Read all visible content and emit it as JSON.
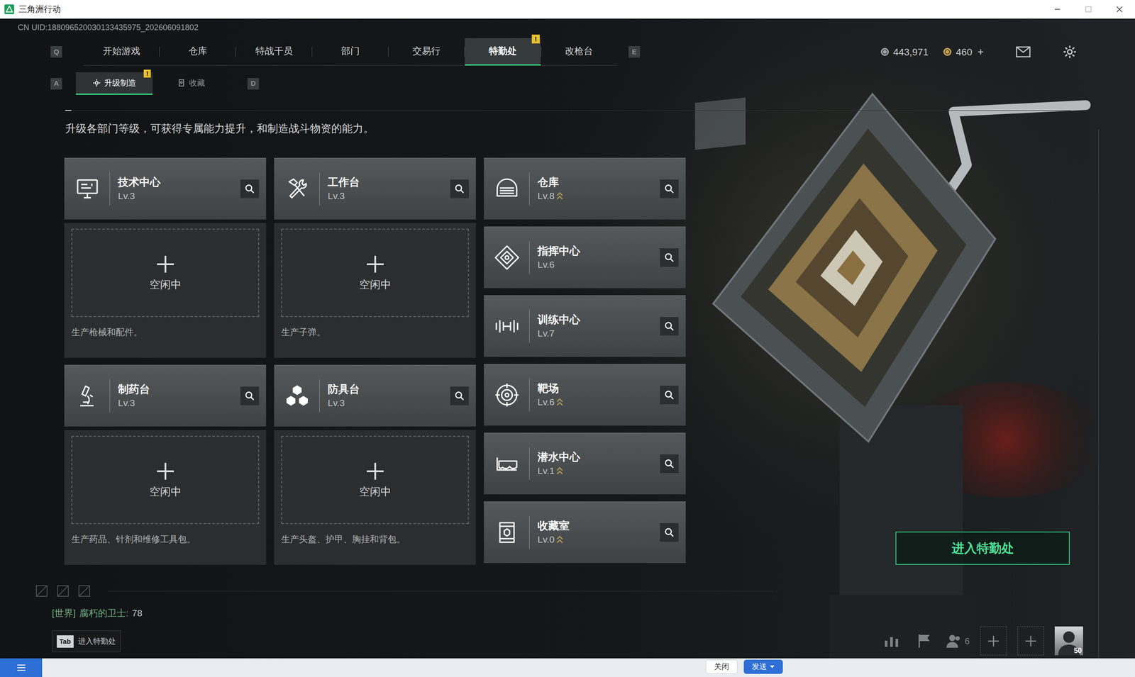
{
  "window": {
    "title": "三角洲行动"
  },
  "uid": "CN UID:188096520030133435975_202606091802",
  "nav": {
    "left_key": "Q",
    "right_key": "E",
    "tabs": [
      {
        "label": "开始游戏",
        "selected": false
      },
      {
        "label": "仓库",
        "selected": false
      },
      {
        "label": "特战干员",
        "selected": false
      },
      {
        "label": "部门",
        "selected": false
      },
      {
        "label": "交易行",
        "selected": false
      },
      {
        "label": "特勤处",
        "selected": true,
        "badge": "!"
      },
      {
        "label": "改枪台",
        "selected": false
      }
    ]
  },
  "currency": [
    {
      "amount": "443,971"
    },
    {
      "amount": "460",
      "add": "+"
    }
  ],
  "subnav": {
    "left_key": "A",
    "right_key": "D",
    "tabs": [
      {
        "label": "升级制造",
        "selected": true,
        "badge": "!"
      },
      {
        "label": "收藏",
        "selected": false
      }
    ]
  },
  "description": "升级各部门等级，可获得专属能力提升，和制造战斗物资的能力。",
  "stations": [
    {
      "name": "技术中心",
      "level": "Lv.3",
      "status": "空闲中",
      "caption": "生产枪械和配件。"
    },
    {
      "name": "工作台",
      "level": "Lv.3",
      "status": "空闲中",
      "caption": "生产子弹。"
    },
    {
      "name": "制药台",
      "level": "Lv.3",
      "status": "空闲中",
      "caption": "生产药品、针剂和维修工具包。"
    },
    {
      "name": "防具台",
      "level": "Lv.3",
      "status": "空闲中",
      "caption": "生产头盔、护甲、胸挂和背包。"
    }
  ],
  "departments": [
    {
      "name": "仓库",
      "level": "Lv.8",
      "upgradable": true
    },
    {
      "name": "指挥中心",
      "level": "Lv.6",
      "upgradable": false
    },
    {
      "name": "训练中心",
      "level": "Lv.7",
      "upgradable": false
    },
    {
      "name": "靶场",
      "level": "Lv.6",
      "upgradable": true
    },
    {
      "name": "潜水中心",
      "level": "Lv.1",
      "upgradable": true
    },
    {
      "name": "收藏室",
      "level": "Lv.0",
      "upgradable": true
    }
  ],
  "enter_button": "进入特勤处",
  "chat": {
    "channel": "[世界]",
    "sender": "腐朽的卫士:",
    "message": "78"
  },
  "tab_hint": {
    "key": "Tab",
    "label": "进入特勤处"
  },
  "toolbar": {
    "friends_count": "6",
    "avatar_level": "50"
  },
  "taskbar": {
    "buttons": [
      "关闭",
      "发送"
    ]
  }
}
